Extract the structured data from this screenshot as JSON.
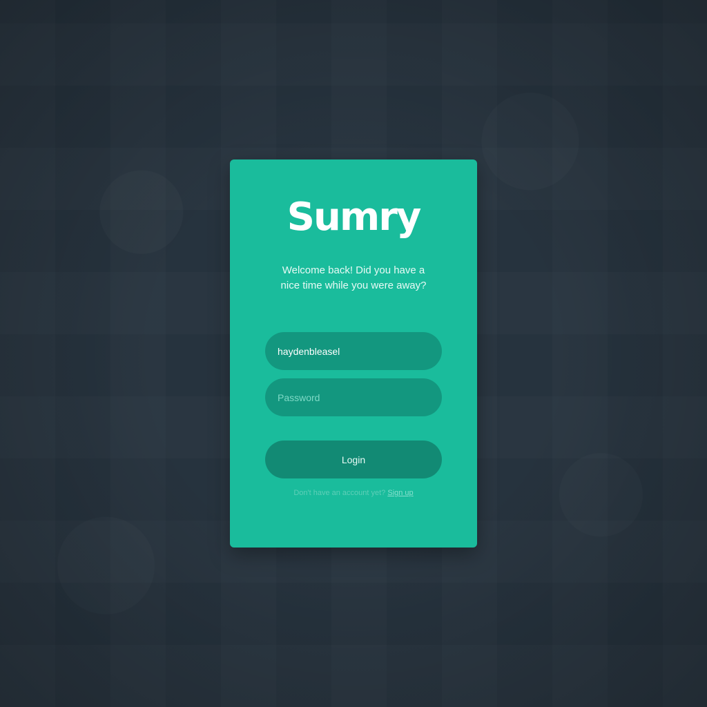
{
  "theme": {
    "accent": "#1abc9c",
    "background": "#283540"
  },
  "login_card": {
    "logo": "Sumry",
    "welcome_text": "Welcome back! Did you have a nice time while you were away?",
    "username": {
      "value": "haydenbleasel"
    },
    "password": {
      "placeholder": "Password",
      "value": ""
    },
    "login_button": "Login",
    "signup_prompt": "Don't have an account yet?",
    "signup_link": "Sign up"
  }
}
